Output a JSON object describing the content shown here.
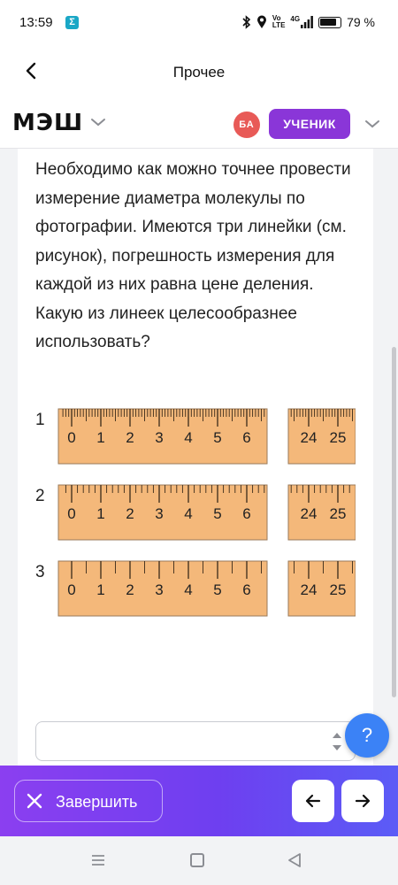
{
  "status_bar": {
    "time": "13:59",
    "app_icon_letter": "Σ",
    "volte_top": "Vo",
    "volte_bottom": "LTE",
    "network": "4G",
    "battery": "79 %"
  },
  "nav": {
    "title": "Прочее",
    "back_icon": "chevron-left-icon"
  },
  "brand": {
    "logo": "МЭШ",
    "avatar_initials": "БА",
    "role": "УЧЕНИК",
    "accent_color": "#8a36d8"
  },
  "question": {
    "text": "Необходимо как можно точнее провести измерение диаметра молекулы по фотографии. Имеются три линейки (см. рисунок), погрешность измерения для каждой из них равна цене деления. Какую из линеек целесообразнее использовать?"
  },
  "figure": {
    "ruler_color": "#f4b87a",
    "rulers": [
      {
        "number": "1",
        "labels": [
          "0",
          "1",
          "2",
          "3",
          "4",
          "5",
          "6"
        ],
        "right_labels": [
          "24",
          "25"
        ],
        "divisions_per_unit": 10
      },
      {
        "number": "2",
        "labels": [
          "0",
          "1",
          "2",
          "3",
          "4",
          "5",
          "6"
        ],
        "right_labels": [
          "24",
          "25"
        ],
        "divisions_per_unit": 5
      },
      {
        "number": "3",
        "labels": [
          "0",
          "1",
          "2",
          "3",
          "4",
          "5",
          "6"
        ],
        "right_labels": [
          "24",
          "25"
        ],
        "divisions_per_unit": 2
      }
    ]
  },
  "answer": {
    "value": "",
    "stepper_icon": "stepper-arrows-icon"
  },
  "help": {
    "label": "?"
  },
  "actions": {
    "finish_label": "Завершить",
    "finish_icon": "close-icon",
    "prev_icon": "arrow-left-icon",
    "next_icon": "arrow-right-icon",
    "gradient_colors": [
      "#8b3ff0",
      "#5b5cf6"
    ]
  },
  "system_nav": {
    "icons": [
      "recents-icon",
      "home-icon",
      "back-triangle-icon"
    ]
  }
}
